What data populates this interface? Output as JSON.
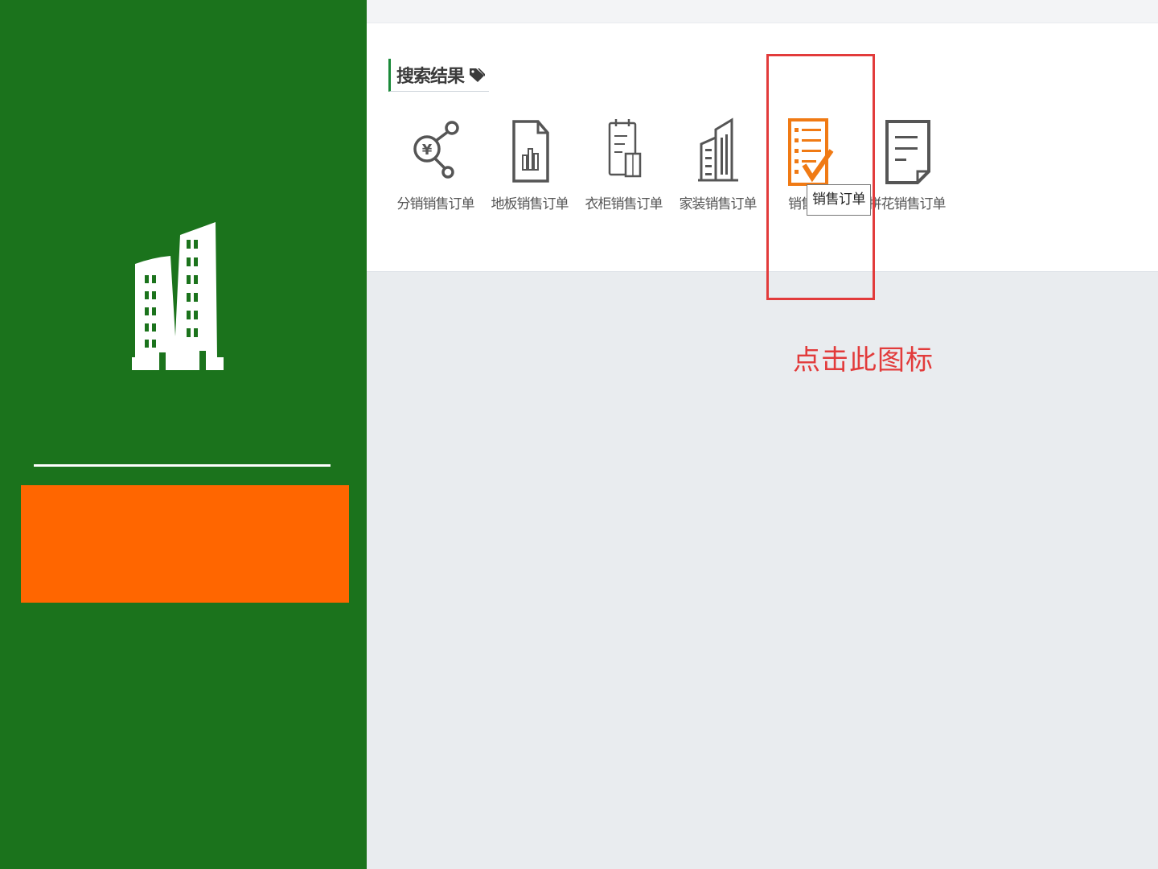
{
  "colors": {
    "sidebar_bg": "#1b731c",
    "sidebar_block": "#ff6600",
    "accent_green": "#1b8a3a",
    "highlight_red": "#e23b3b",
    "icon_orange": "#f07a14",
    "icon_gray": "#555555"
  },
  "sidebar": {
    "logo_icon": "building-icon"
  },
  "search_results": {
    "title": "搜索结果",
    "title_icon": "tag-icon",
    "items": [
      {
        "label": "分销销售订单",
        "icon": "distribution-yuan-icon"
      },
      {
        "label": "地板销售订单",
        "icon": "floor-document-icon"
      },
      {
        "label": "衣柜销售订单",
        "icon": "wardrobe-clipboard-icon"
      },
      {
        "label": "家装销售订单",
        "icon": "building-icon"
      },
      {
        "label": "销售订单",
        "icon": "checklist-icon"
      },
      {
        "label": "拼花销售订单",
        "icon": "document-icon"
      }
    ],
    "tooltip": "销售订单",
    "item_4_visible_label": "销售"
  },
  "annotation": {
    "callout": "点击此图标"
  }
}
